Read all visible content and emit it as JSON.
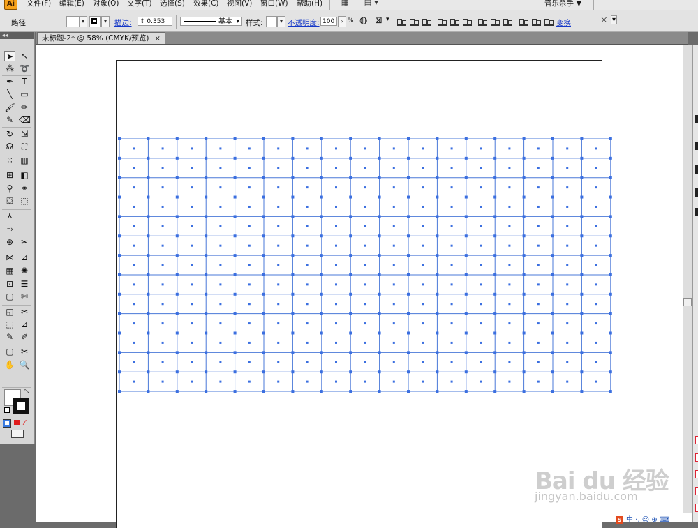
{
  "app": {
    "logo_text": "Ai",
    "menus": [
      "文件(F)",
      "编辑(E)",
      "对象(O)",
      "文字(T)",
      "选择(S)",
      "效果(C)",
      "视图(V)",
      "窗口(W)",
      "帮助(H)"
    ],
    "workspace": "音乐杀手 ▼"
  },
  "control_bar": {
    "object_type": "路径",
    "stroke_label": "描边:",
    "stroke_weight": "0.353",
    "brush_label": "基本",
    "style_label": "样式:",
    "opacity_label": "不透明度:",
    "opacity_value": "100",
    "opacity_unit": "%",
    "transform_label": "变换"
  },
  "document": {
    "tab_title": "未标题-2* @ 58% (CMYK/预览)",
    "close_glyph": "×",
    "zoom_percent": 58,
    "color_mode": "CMYK"
  },
  "grid": {
    "columns": 17,
    "rows": 13,
    "stroke_color": "#4a78d8",
    "anchor_color": "#3b6fe0"
  },
  "toolbox": {
    "collapse_glyph": "◂◂",
    "tools": [
      [
        "selection-tool",
        "➤"
      ],
      [
        "direct-selection-tool",
        "↖"
      ],
      [
        "magic-wand-tool",
        "⁂"
      ],
      [
        "lasso-tool",
        "➰"
      ],
      [
        "pen-tool",
        "✒"
      ],
      [
        "type-tool",
        "T"
      ],
      [
        "line-tool",
        "╲"
      ],
      [
        "rectangle-tool",
        "▭"
      ],
      [
        "paintbrush-tool",
        "🖌"
      ],
      [
        "pencil-tool",
        "✏"
      ],
      [
        "blob-brush-tool",
        "✎"
      ],
      [
        "eraser-tool",
        "⌫"
      ],
      [
        "rotate-tool",
        "↻"
      ],
      [
        "scale-tool",
        "⇲"
      ],
      [
        "warp-tool",
        "☊"
      ],
      [
        "free-transform-tool",
        "⛶"
      ],
      [
        "symbol-sprayer-tool",
        "⁙"
      ],
      [
        "column-graph-tool",
        "▥"
      ],
      [
        "mesh-tool",
        "⊞"
      ],
      [
        "gradient-tool",
        "◧"
      ],
      [
        "eyedropper-tool",
        "⚲"
      ],
      [
        "blend-tool",
        "⚭"
      ],
      [
        "live-paint-bucket-tool",
        "⛋"
      ],
      [
        "live-paint-selection-tool",
        "⬚"
      ],
      [
        "width-tool-a",
        "⋏"
      ],
      [
        "width-tool-b",
        "⤳"
      ],
      [
        "crop-tool",
        "⊕"
      ],
      [
        "slice-tool",
        "✂"
      ],
      [
        "perspective-grid-tool",
        "⋈"
      ],
      [
        "shape-builder-tool",
        "⊿"
      ],
      [
        "chart-tool",
        "▦"
      ],
      [
        "twirl-tool",
        "✺"
      ],
      [
        "artboard-tool",
        "⊡"
      ],
      [
        "align-tool",
        "☰"
      ],
      [
        "rect-alt-tool",
        "▢"
      ],
      [
        "knife-tool",
        "✄"
      ],
      [
        "rect-alt2-tool",
        "◱"
      ],
      [
        "reshape-tool",
        "✂"
      ],
      [
        "hand-sel-tool",
        "⬚"
      ],
      [
        "rotate-alt-tool",
        "⊿"
      ],
      [
        "eyedropper-alt-tool",
        "✎"
      ],
      [
        "measure-tool",
        "✐"
      ],
      [
        "crop-alt-tool",
        "▢"
      ],
      [
        "scissors-tool",
        "✂"
      ],
      [
        "hand-tool",
        "✋"
      ],
      [
        "zoom-tool",
        "🔍"
      ]
    ]
  },
  "watermark": {
    "text": "Bai du 经验",
    "url": "jingyan.baidu.com"
  },
  "ime": {
    "logo": "S",
    "text": "中 ·, ☺ ⊕ ⌨"
  }
}
